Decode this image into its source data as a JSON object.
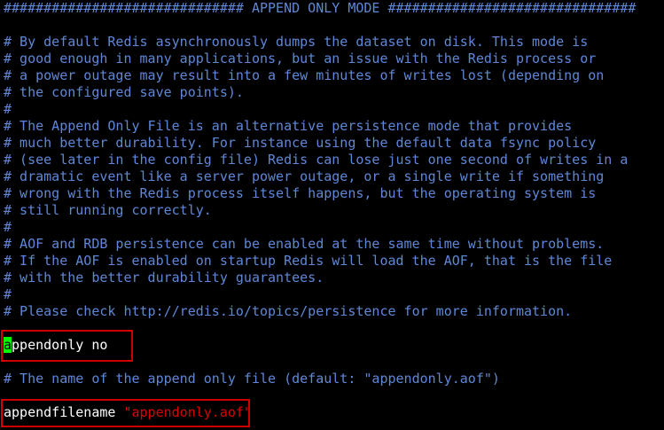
{
  "terminal": {
    "comment_lines": [
      "############################## APPEND ONLY MODE ###############################",
      "",
      "# By default Redis asynchronously dumps the dataset on disk. This mode is",
      "# good enough in many applications, but an issue with the Redis process or",
      "# a power outage may result into a few minutes of writes lost (depending on",
      "# the configured save points).",
      "#",
      "# The Append Only File is an alternative persistence mode that provides",
      "# much better durability. For instance using the default data fsync policy",
      "# (see later in the config file) Redis can lose just one second of writes in a",
      "# dramatic event like a server power outage, or a single write if something",
      "# wrong with the Redis process itself happens, but the operating system is",
      "# still running correctly.",
      "#",
      "# AOF and RDB persistence can be enabled at the same time without problems.",
      "# If the AOF is enabled on startup Redis will load the AOF, that is the file",
      "# with the better durability guarantees.",
      "#",
      "# Please check http://redis.io/topics/persistence for more information."
    ],
    "appendonly": {
      "cursor_char": "a",
      "rest": "ppendonly no"
    },
    "filename_comment": "# The name of the append only file (default: \"appendonly.aof\")",
    "appendfilename": {
      "key": "appendfilename ",
      "value": "\"appendonly.aof\""
    }
  },
  "colors": {
    "comment": "#5f87d7",
    "text": "#ffffff",
    "string": "#d70000",
    "cursor": "#00ff00",
    "highlight_border": "#d00000",
    "background": "#000000"
  }
}
